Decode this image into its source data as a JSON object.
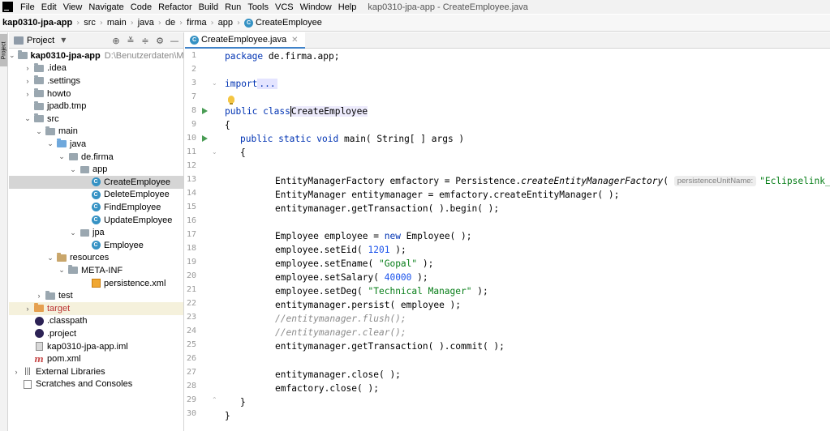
{
  "menu": {
    "items": [
      "File",
      "Edit",
      "View",
      "Navigate",
      "Code",
      "Refactor",
      "Build",
      "Run",
      "Tools",
      "VCS",
      "Window",
      "Help"
    ],
    "window_title": "kap0310-jpa-app - CreateEmployee.java"
  },
  "breadcrumb": {
    "items": [
      "kap0310-jpa-app",
      "src",
      "main",
      "java",
      "de",
      "firma",
      "app",
      "CreateEmployee"
    ]
  },
  "tool_stripe": {
    "project_label": "Project"
  },
  "project_panel": {
    "title": "Project",
    "tree": [
      {
        "label": "kap0310-jpa-app",
        "extra": "D:\\Benutzerdaten\\Mertens",
        "icon": "project-icon",
        "arrow": "down",
        "indent": 0
      },
      {
        "label": ".idea",
        "icon": "folder-icon",
        "arrow": "right",
        "indent": 1
      },
      {
        "label": ".settings",
        "icon": "folder-icon",
        "arrow": "right",
        "indent": 1
      },
      {
        "label": "howto",
        "icon": "folder-icon",
        "arrow": "right",
        "indent": 1
      },
      {
        "label": "jpadb.tmp",
        "icon": "folder-icon",
        "arrow": "",
        "indent": 1
      },
      {
        "label": "src",
        "icon": "folder-icon",
        "arrow": "down",
        "indent": 1
      },
      {
        "label": "main",
        "icon": "folder-icon",
        "arrow": "down",
        "indent": 2
      },
      {
        "label": "java",
        "icon": "source-folder-icon",
        "arrow": "down",
        "indent": 3
      },
      {
        "label": "de.firma",
        "icon": "package-icon",
        "arrow": "down",
        "indent": 4
      },
      {
        "label": "app",
        "icon": "package-icon",
        "arrow": "down",
        "indent": 5
      },
      {
        "label": "CreateEmployee",
        "icon": "class-icon",
        "arrow": "",
        "indent": 6,
        "selected": true
      },
      {
        "label": "DeleteEmployee",
        "icon": "class-icon",
        "arrow": "",
        "indent": 6
      },
      {
        "label": "FindEmployee",
        "icon": "class-icon",
        "arrow": "",
        "indent": 6
      },
      {
        "label": "UpdateEmployee",
        "icon": "class-icon",
        "arrow": "",
        "indent": 6
      },
      {
        "label": "jpa",
        "icon": "package-icon",
        "arrow": "down",
        "indent": 5
      },
      {
        "label": "Employee",
        "icon": "class-icon",
        "arrow": "",
        "indent": 6
      },
      {
        "label": "resources",
        "icon": "resources-folder-icon",
        "arrow": "down",
        "indent": 3
      },
      {
        "label": "META-INF",
        "icon": "folder-icon",
        "arrow": "down",
        "indent": 4
      },
      {
        "label": "persistence.xml",
        "icon": "xml-file-icon",
        "arrow": "",
        "indent": 6
      },
      {
        "label": "test",
        "icon": "folder-icon",
        "arrow": "right",
        "indent": 2
      },
      {
        "label": "target",
        "icon": "excluded-folder-icon",
        "arrow": "right",
        "indent": 1,
        "highlight": true
      },
      {
        "label": ".classpath",
        "icon": "eclipse-file-icon",
        "arrow": "",
        "indent": 1
      },
      {
        "label": ".project",
        "icon": "eclipse-file-icon",
        "arrow": "",
        "indent": 1
      },
      {
        "label": "kap0310-jpa-app.iml",
        "icon": "iml-file-icon",
        "arrow": "",
        "indent": 1
      },
      {
        "label": "pom.xml",
        "icon": "maven-icon",
        "arrow": "",
        "indent": 1
      },
      {
        "label": "External Libraries",
        "icon": "libraries-icon",
        "arrow": "right",
        "indent": 0
      },
      {
        "label": "Scratches and Consoles",
        "icon": "scratch-icon",
        "arrow": "",
        "indent": 0
      }
    ]
  },
  "editor": {
    "tab_label": "CreateEmployee.java",
    "hint_label": "persistenceUnitName:",
    "line_numbers": [
      "1",
      "2",
      "3",
      "7",
      "8",
      "9",
      "10",
      "11",
      "12",
      "13",
      "14",
      "15",
      "16",
      "17",
      "18",
      "19",
      "20",
      "21",
      "22",
      "23",
      "24",
      "25",
      "26",
      "27",
      "28",
      "29",
      "30"
    ]
  },
  "code": {
    "l1_kw": "package",
    "l1_rest": " de.firma.app;",
    "l3_kw": "import",
    "l3_fold": "...",
    "l8_kw": "public class",
    "l8_cls": "CreateEmployee",
    "l9": "{",
    "l10_kw": "public static void",
    "l10_rest": " main( String[ ] args )",
    "l11": "{",
    "l13_a": "EntityManagerFactory emfactory = Persistence.",
    "l13_b": "createEntityManagerFactory",
    "l13_c": "( ",
    "l13_str": "\"Eclipselink_JPA\"",
    "l13_d": " );",
    "l14": "EntityManager entitymanager = emfactory.createEntityManager( );",
    "l15": "entitymanager.getTransaction( ).begin( );",
    "l17_a": "Employee employee = ",
    "l17_kw": "new",
    "l17_b": " Employee( );",
    "l18_a": "employee.setEid( ",
    "l18_num": "1201",
    "l18_b": " );",
    "l19_a": "employee.setEname( ",
    "l19_str": "\"Gopal\"",
    "l19_b": " );",
    "l20_a": "employee.setSalary( ",
    "l20_num": "40000",
    "l20_b": " );",
    "l21_a": "employee.setDeg( ",
    "l21_str": "\"Technical Manager\"",
    "l21_b": " );",
    "l22": "entitymanager.persist( employee );",
    "l23": "//entitymanager.flush();",
    "l24": "//entitymanager.clear();",
    "l25": "entitymanager.getTransaction( ).commit( );",
    "l27": "entitymanager.close( );",
    "l28": "emfactory.close( );",
    "l29": "}",
    "l30": "}"
  },
  "colors": {
    "keyword": "#0033b3",
    "string": "#067d17",
    "number": "#1750eb",
    "comment": "#8c8c8c",
    "selection": "#d5d5d5",
    "class_icon": "#3592c4",
    "run_icon": "#499c54"
  }
}
